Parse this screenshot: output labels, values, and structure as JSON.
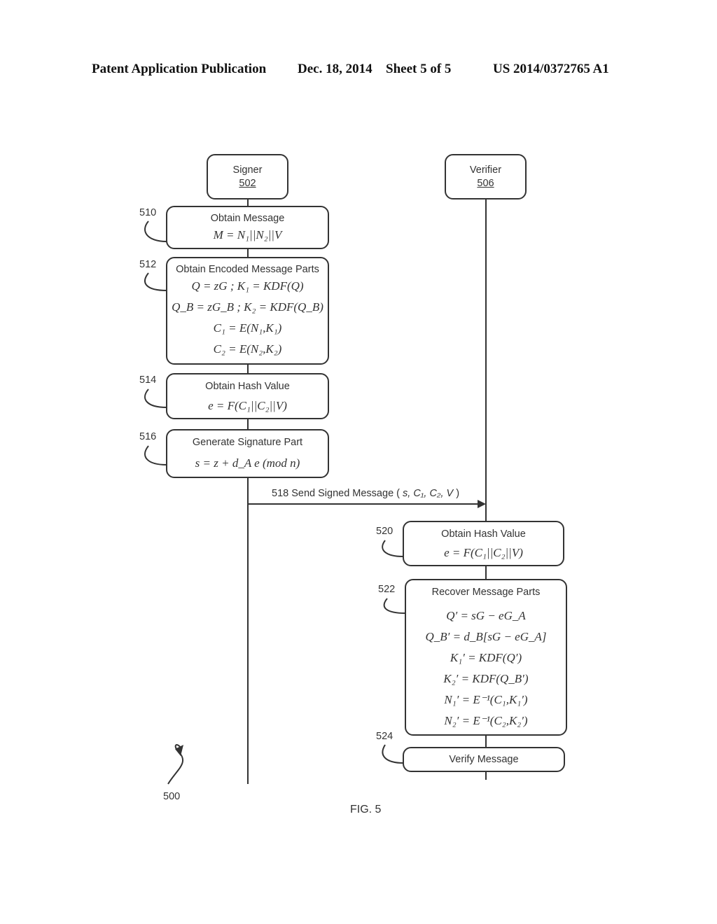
{
  "header": {
    "publication": "Patent Application Publication",
    "date": "Dec. 18, 2014",
    "sheet": "Sheet 5 of 5",
    "number": "US 2014/0372765 A1"
  },
  "actors": {
    "signer": {
      "label": "Signer",
      "ref": "502"
    },
    "verifier": {
      "label": "Verifier",
      "ref": "506"
    }
  },
  "steps": {
    "s510": {
      "ref": "510",
      "title": "Obtain Message",
      "equations": [
        "M = N₁||N₂||V"
      ]
    },
    "s512": {
      "ref": "512",
      "title": "Obtain Encoded Message Parts",
      "equations": [
        "Q = zG ; K₁ = KDF(Q)",
        "Q_B = zG_B ; K₂ = KDF(Q_B)",
        "C₁ = E(N₁,K₁)",
        "C₂ = E(N₂,K₂)"
      ]
    },
    "s514": {
      "ref": "514",
      "title": "Obtain Hash Value",
      "equations": [
        "e = F(C₁||C₂||V)"
      ]
    },
    "s516": {
      "ref": "516",
      "title": "Generate Signature Part",
      "equations": [
        "s = z + d_A e (mod n)"
      ]
    },
    "s518": {
      "ref": "518",
      "label": "518 Send Signed Message (",
      "params": "s, C₁, C₂, V",
      "close": ")"
    },
    "s520": {
      "ref": "520",
      "title": "Obtain Hash Value",
      "equations": [
        "e = F(C₁||C₂||V)"
      ]
    },
    "s522": {
      "ref": "522",
      "title": "Recover Message Parts",
      "equations": [
        "Q′ = sG − eG_A",
        "Q_B′ = d_B[sG − eG_A]",
        "K₁′ = KDF(Q′)",
        "K₂′ = KDF(Q_B′)",
        "N₁′ = E⁻¹(C₁,K₁′)",
        "N₂′ = E⁻¹(C₂,K₂′)"
      ]
    },
    "s524": {
      "ref": "524",
      "title": "Verify Message"
    }
  },
  "figure_ref": "500",
  "figure_caption": "FIG. 5"
}
